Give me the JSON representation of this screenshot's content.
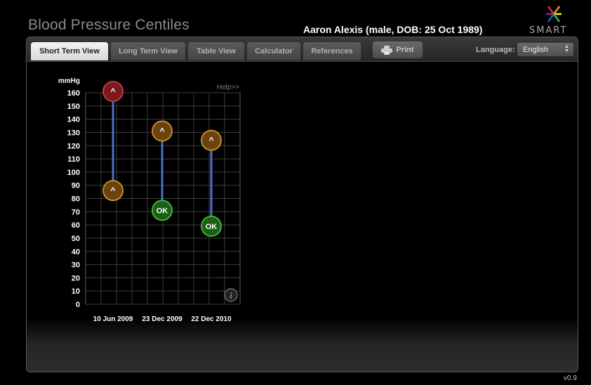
{
  "app": {
    "title": "Blood Pressure Centiles",
    "patient": "Aaron Alexis (male, DOB: 25 Oct 1989)",
    "logo_text": "SMART",
    "version": "v0.9"
  },
  "tabs": [
    {
      "label": "Short Term View",
      "active": true
    },
    {
      "label": "Long Term View",
      "active": false
    },
    {
      "label": "Table View",
      "active": false
    },
    {
      "label": "Calculator",
      "active": false
    },
    {
      "label": "References",
      "active": false
    }
  ],
  "toolbar": {
    "print_label": "Print",
    "print_icon": "printer-icon",
    "language_label": "Language:",
    "language_value": "English"
  },
  "chart": {
    "help_label": "Help>>",
    "info_icon": "info-icon"
  },
  "chart_data": {
    "type": "range",
    "ylabel": "mmHg",
    "ylim": [
      0,
      160
    ],
    "yticks": [
      0,
      10,
      20,
      30,
      40,
      50,
      60,
      70,
      80,
      90,
      100,
      110,
      120,
      130,
      140,
      150,
      160
    ],
    "grid": true,
    "categories": [
      "10 Jun 2009",
      "23 Dec 2009",
      "22 Dec 2010"
    ],
    "series": [
      {
        "values": [
          161,
          131,
          124
        ],
        "labels": [
          "^",
          "^",
          "^"
        ],
        "status": [
          "high",
          "elevated",
          "elevated"
        ]
      },
      {
        "values": [
          86,
          71,
          59
        ],
        "labels": [
          "^",
          "OK",
          "OK"
        ],
        "status": [
          "elevated",
          "ok",
          "ok"
        ]
      }
    ],
    "colors": {
      "high": "#8e1c22",
      "elevated": "#7a4a12",
      "ok": "#1b6a16",
      "connector": "#4a72c4"
    }
  }
}
